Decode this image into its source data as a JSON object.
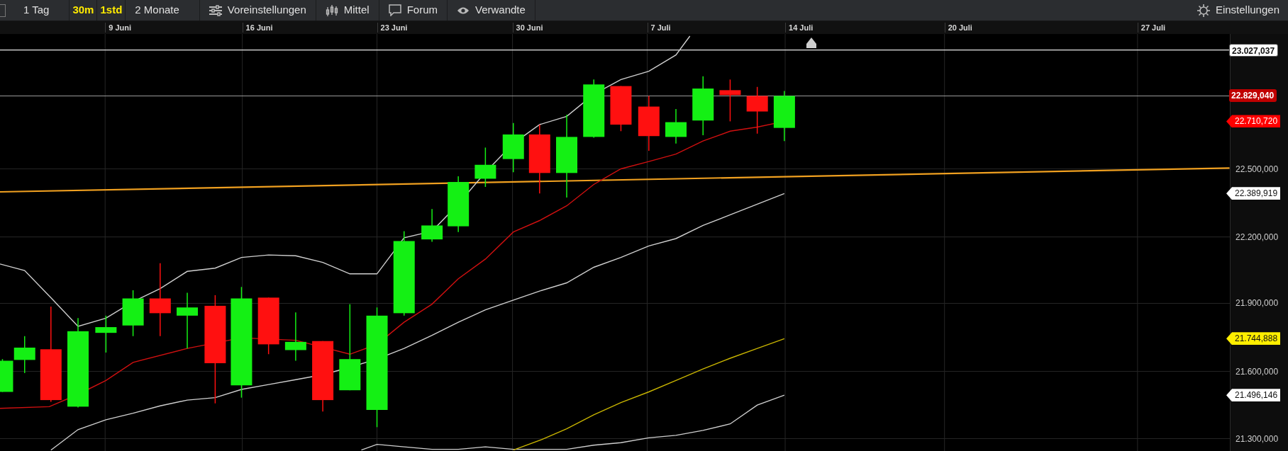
{
  "toolbar": {
    "items": [
      {
        "kind": "range",
        "label": "1 Tag"
      },
      {
        "kind": "interval",
        "label": "30m"
      },
      {
        "kind": "interval",
        "label": "1std"
      },
      {
        "kind": "range",
        "label": "2 Monate"
      },
      {
        "kind": "presets",
        "label": "Voreinstellungen"
      },
      {
        "kind": "indicators",
        "label": "Mittel"
      },
      {
        "kind": "forum",
        "label": "Forum"
      },
      {
        "kind": "related",
        "label": "Verwandte"
      }
    ],
    "settings": {
      "label": "Einstellungen"
    }
  },
  "dates": [
    "9 Juni",
    "16 Juni",
    "23 Juni",
    "30 Juni",
    "7 Juli",
    "14 Juli",
    "20 Juli",
    "27 Juli"
  ],
  "price_axis": {
    "labels": [
      "22.500,000",
      "22.200,000",
      "21.900,000",
      "21.600,000",
      "21.300,000"
    ],
    "tags": [
      {
        "value": "23.027,037",
        "kind": "box",
        "color": "#ffffff"
      },
      {
        "value": "22.829,040",
        "kind": "box",
        "color": "#c00000"
      },
      {
        "value": "22.710,720",
        "kind": "tag",
        "color": "#ff0000"
      },
      {
        "value": "22.389,919",
        "kind": "tag",
        "color": "#ffffff"
      },
      {
        "value": "21.744,888",
        "kind": "tag",
        "color": "#ffee00"
      },
      {
        "value": "21.496,146",
        "kind": "tag",
        "color": "#ffffff"
      }
    ]
  }
}
